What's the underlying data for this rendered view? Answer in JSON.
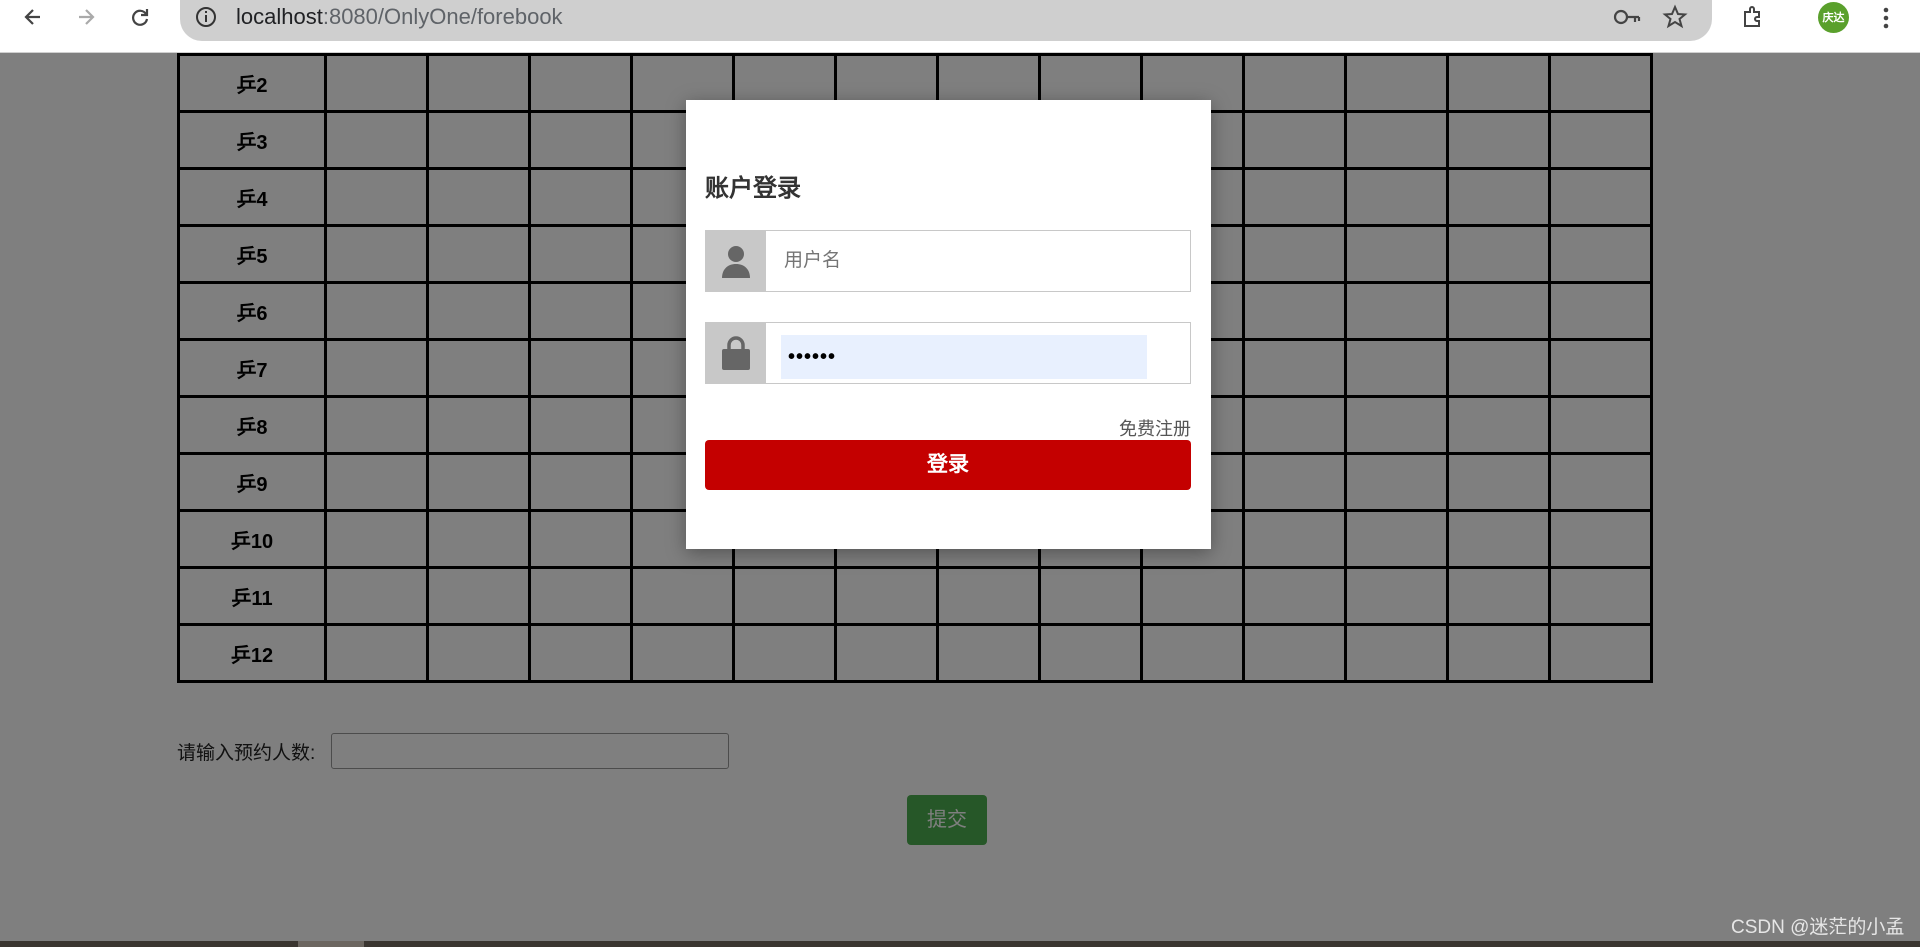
{
  "browser": {
    "url_host": "localhost",
    "url_rest": ":8080/OnlyOne/forebook",
    "avatar_text": "庆达",
    "icons": [
      "back-icon",
      "forward-icon",
      "reload-icon",
      "site-info-icon",
      "key-icon",
      "star-icon",
      "extensions-icon",
      "menu-icon"
    ]
  },
  "table": {
    "rows": [
      "乒2",
      "乒3",
      "乒4",
      "乒5",
      "乒6",
      "乒7",
      "乒8",
      "乒9",
      "乒10",
      "乒11",
      "乒12"
    ],
    "empty_columns": 13
  },
  "form": {
    "count_label": "请输入预约人数:",
    "submit_label": "提交"
  },
  "modal": {
    "title": "账户登录",
    "username_placeholder": "用户名",
    "password_masked": "••••••",
    "register_link": "免费注册",
    "login_button": "登录"
  },
  "watermark": "CSDN @迷茫的小孟",
  "colors": {
    "login_button": "#c40000",
    "submit_button": "#4caf50",
    "overlay": "rgba(0,0,0,0.5)",
    "avatar": "#5aa02c"
  }
}
